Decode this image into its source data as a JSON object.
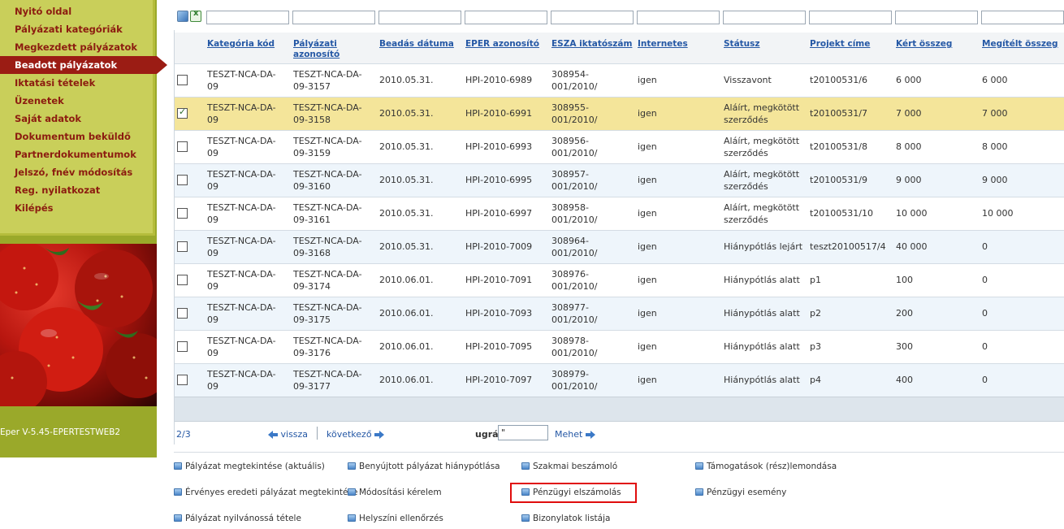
{
  "sidebar": {
    "items": [
      {
        "label": "Nyitó oldal"
      },
      {
        "label": "Pályázati kategóriák"
      },
      {
        "label": "Megkezdett pályázatok"
      },
      {
        "label": "Beadott pályázatok",
        "active": true
      },
      {
        "label": "Iktatási tételek"
      },
      {
        "label": "Üzenetek"
      },
      {
        "label": "Saját adatok"
      },
      {
        "label": "Dokumentum beküldő"
      },
      {
        "label": "Partnerdokumentumok"
      },
      {
        "label": "Jelszó, fnév módosítás"
      },
      {
        "label": "Reg. nyilatkozat"
      },
      {
        "label": "Kilépés"
      }
    ],
    "version": "Eper V-5.45-EPERTESTWEB2"
  },
  "table": {
    "columns": [
      {
        "line1": "Kategória kód",
        "line2": ""
      },
      {
        "line1": "Pályázati",
        "line2": "azonosító"
      },
      {
        "line1": "Beadás dátuma",
        "line2": ""
      },
      {
        "line1": "EPER azonosító",
        "line2": ""
      },
      {
        "line1": "ESZA iktatószám",
        "line2": ""
      },
      {
        "line1": "Internetes",
        "line2": ""
      },
      {
        "line1": "Státusz",
        "line2": ""
      },
      {
        "line1": "Projekt címe",
        "line2": ""
      },
      {
        "line1": "Kért összeg",
        "line2": ""
      },
      {
        "line1": "Megítélt összeg",
        "line2": ""
      }
    ],
    "rows": [
      {
        "checked": false,
        "kat": [
          "TESZT-NCA-DA-",
          "09"
        ],
        "azon": [
          "TESZT-NCA-DA-",
          "09-3157"
        ],
        "datum": "2010.05.31.",
        "eper": "HPI-2010-6989",
        "esza": [
          "308954-",
          "001/2010/"
        ],
        "internetes": "igen",
        "statusz": [
          "Visszavont",
          ""
        ],
        "projekt": "t20100531/6",
        "kert": "6 000",
        "megitelt": "6 000"
      },
      {
        "checked": true,
        "kat": [
          "TESZT-NCA-DA-",
          "09"
        ],
        "azon": [
          "TESZT-NCA-DA-",
          "09-3158"
        ],
        "datum": "2010.05.31.",
        "eper": "HPI-2010-6991",
        "esza": [
          "308955-",
          "001/2010/"
        ],
        "internetes": "igen",
        "statusz": [
          "Aláírt, megkötött",
          "szerződés"
        ],
        "projekt": "t20100531/7",
        "kert": "7 000",
        "megitelt": "7 000"
      },
      {
        "checked": false,
        "kat": [
          "TESZT-NCA-DA-",
          "09"
        ],
        "azon": [
          "TESZT-NCA-DA-",
          "09-3159"
        ],
        "datum": "2010.05.31.",
        "eper": "HPI-2010-6993",
        "esza": [
          "308956-",
          "001/2010/"
        ],
        "internetes": "igen",
        "statusz": [
          "Aláírt, megkötött",
          "szerződés"
        ],
        "projekt": "t20100531/8",
        "kert": "8 000",
        "megitelt": "8 000"
      },
      {
        "checked": false,
        "kat": [
          "TESZT-NCA-DA-",
          "09"
        ],
        "azon": [
          "TESZT-NCA-DA-",
          "09-3160"
        ],
        "datum": "2010.05.31.",
        "eper": "HPI-2010-6995",
        "esza": [
          "308957-",
          "001/2010/"
        ],
        "internetes": "igen",
        "statusz": [
          "Aláírt, megkötött",
          "szerződés"
        ],
        "projekt": "t20100531/9",
        "kert": "9 000",
        "megitelt": "9 000"
      },
      {
        "checked": false,
        "kat": [
          "TESZT-NCA-DA-",
          "09"
        ],
        "azon": [
          "TESZT-NCA-DA-",
          "09-3161"
        ],
        "datum": "2010.05.31.",
        "eper": "HPI-2010-6997",
        "esza": [
          "308958-",
          "001/2010/"
        ],
        "internetes": "igen",
        "statusz": [
          "Aláírt, megkötött",
          "szerződés"
        ],
        "projekt": "t20100531/10",
        "kert": "10 000",
        "megitelt": "10 000"
      },
      {
        "checked": false,
        "kat": [
          "TESZT-NCA-DA-",
          "09"
        ],
        "azon": [
          "TESZT-NCA-DA-",
          "09-3168"
        ],
        "datum": "2010.05.31.",
        "eper": "HPI-2010-7009",
        "esza": [
          "308964-",
          "001/2010/"
        ],
        "internetes": "igen",
        "statusz": [
          "Hiánypótlás lejárt",
          ""
        ],
        "projekt": "teszt20100517/4",
        "kert": "40 000",
        "megitelt": "0"
      },
      {
        "checked": false,
        "kat": [
          "TESZT-NCA-DA-",
          "09"
        ],
        "azon": [
          "TESZT-NCA-DA-",
          "09-3174"
        ],
        "datum": "2010.06.01.",
        "eper": "HPI-2010-7091",
        "esza": [
          "308976-",
          "001/2010/"
        ],
        "internetes": "igen",
        "statusz": [
          "Hiánypótlás alatt",
          ""
        ],
        "projekt": "p1",
        "kert": "100",
        "megitelt": "0"
      },
      {
        "checked": false,
        "kat": [
          "TESZT-NCA-DA-",
          "09"
        ],
        "azon": [
          "TESZT-NCA-DA-",
          "09-3175"
        ],
        "datum": "2010.06.01.",
        "eper": "HPI-2010-7093",
        "esza": [
          "308977-",
          "001/2010/"
        ],
        "internetes": "igen",
        "statusz": [
          "Hiánypótlás alatt",
          ""
        ],
        "projekt": "p2",
        "kert": "200",
        "megitelt": "0"
      },
      {
        "checked": false,
        "kat": [
          "TESZT-NCA-DA-",
          "09"
        ],
        "azon": [
          "TESZT-NCA-DA-",
          "09-3176"
        ],
        "datum": "2010.06.01.",
        "eper": "HPI-2010-7095",
        "esza": [
          "308978-",
          "001/2010/"
        ],
        "internetes": "igen",
        "statusz": [
          "Hiánypótlás alatt",
          ""
        ],
        "projekt": "p3",
        "kert": "300",
        "megitelt": "0"
      },
      {
        "checked": false,
        "kat": [
          "TESZT-NCA-DA-",
          "09"
        ],
        "azon": [
          "TESZT-NCA-DA-",
          "09-3177"
        ],
        "datum": "2010.06.01.",
        "eper": "HPI-2010-7097",
        "esza": [
          "308979-",
          "001/2010/"
        ],
        "internetes": "igen",
        "statusz": [
          "Hiánypótlás alatt",
          ""
        ],
        "projekt": "p4",
        "kert": "400",
        "megitelt": "0"
      }
    ]
  },
  "pager": {
    "page": "2/3",
    "prev_label": "vissza",
    "next_label": "következő",
    "goto_label": "ugrás:",
    "goto_value": "\"",
    "go_label": "Mehet"
  },
  "actions": [
    [
      "Pályázat megtekintése (aktuális)",
      "Benyújtott pályázat hiánypótlása",
      "Szakmai beszámoló",
      "Támogatások (rész)lemondása"
    ],
    [
      "Érvényes eredeti pályázat megtekintése",
      "Módosítási kérelem",
      "Pénzügyi elszámolás",
      "Pénzügyi esemény"
    ],
    [
      "Pályázat nyilvánossá tétele",
      "Helyszíni ellenőrzés",
      "Bizonylatok listája",
      ""
    ]
  ],
  "colors": {
    "menu_bg": "#c9cf5a",
    "menu_text": "#8c1c10",
    "active_bg": "#9b1c14",
    "selected_row": "#f4e59a",
    "link": "#2558a5",
    "highlight_box": "#e00d0d"
  }
}
